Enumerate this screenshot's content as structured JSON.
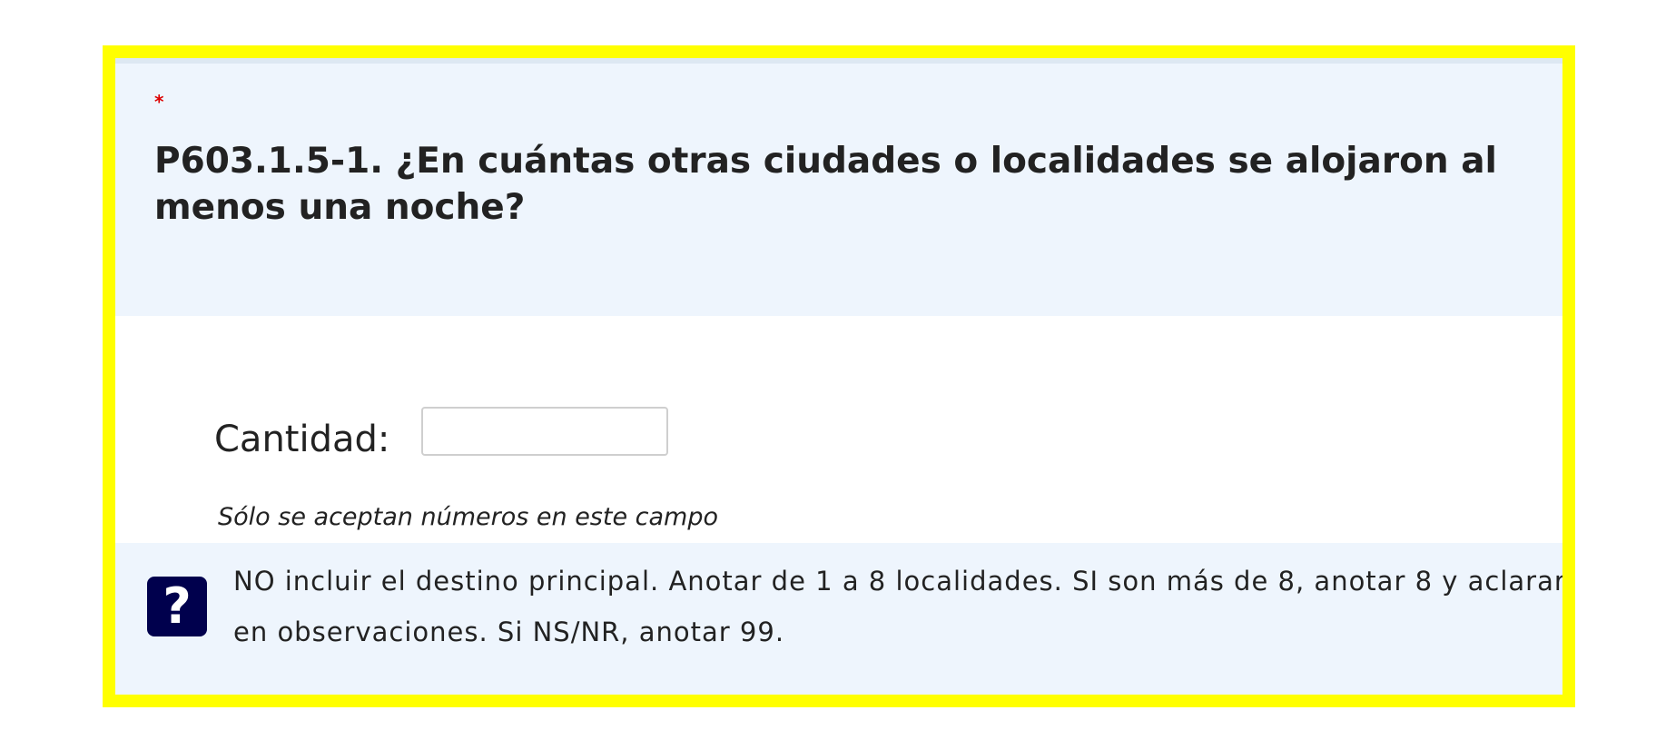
{
  "question": {
    "mandatory_marker": "*",
    "text": "P603.1.5-1. ¿En cuántas otras ciudades o localidades se alojaron al menos una noche?"
  },
  "answer": {
    "label": "Cantidad:",
    "value": "",
    "hint": "Sólo se aceptan números en este campo"
  },
  "help": {
    "icon": "question-mark-icon",
    "icon_glyph": "?",
    "text": "NO incluir el destino principal. Anotar de 1 a 8 localidades. SI son más de 8, anotar 8 y aclarar en observaciones. Si NS/NR, anotar 99."
  },
  "colors": {
    "highlight_border": "#ffff00",
    "header_bg": "#eef5fd",
    "mandatory": "#dd0000",
    "help_icon_bg": "#00004d"
  }
}
